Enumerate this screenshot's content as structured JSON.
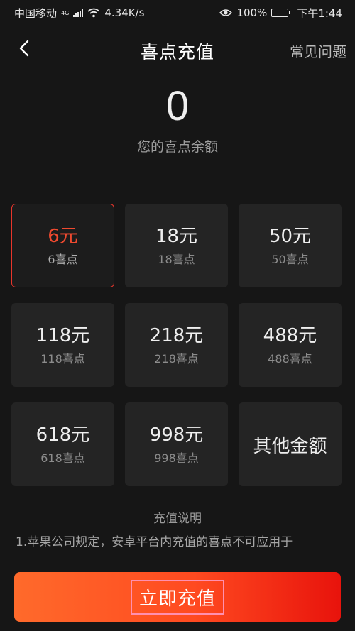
{
  "status_bar": {
    "carrier": "中国移动",
    "network_type": "4G",
    "speed": "4.34K/s",
    "battery_percent": "100%",
    "time": "下午1:44"
  },
  "nav": {
    "title": "喜点充值",
    "faq_label": "常见问题"
  },
  "balance": {
    "value": "0",
    "label": "您的喜点余额"
  },
  "packages": [
    {
      "price": "6元",
      "points": "6喜点",
      "selected": true
    },
    {
      "price": "18元",
      "points": "18喜点"
    },
    {
      "price": "50元",
      "points": "50喜点"
    },
    {
      "price": "118元",
      "points": "118喜点"
    },
    {
      "price": "218元",
      "points": "218喜点"
    },
    {
      "price": "488元",
      "points": "488喜点"
    },
    {
      "price": "618元",
      "points": "618喜点"
    },
    {
      "price": "998元",
      "points": "998喜点"
    }
  ],
  "other_amount_label": "其他金额",
  "notes": {
    "title": "充值说明",
    "line1": "1.苹果公司规定，安卓平台内充值的喜点不可应用于"
  },
  "cta": {
    "label": "立即充值"
  },
  "colors": {
    "accent": "#f04a2f",
    "cta_start": "#ff6a2b",
    "cta_end": "#e8130c",
    "background": "#161616",
    "card": "#242424"
  }
}
